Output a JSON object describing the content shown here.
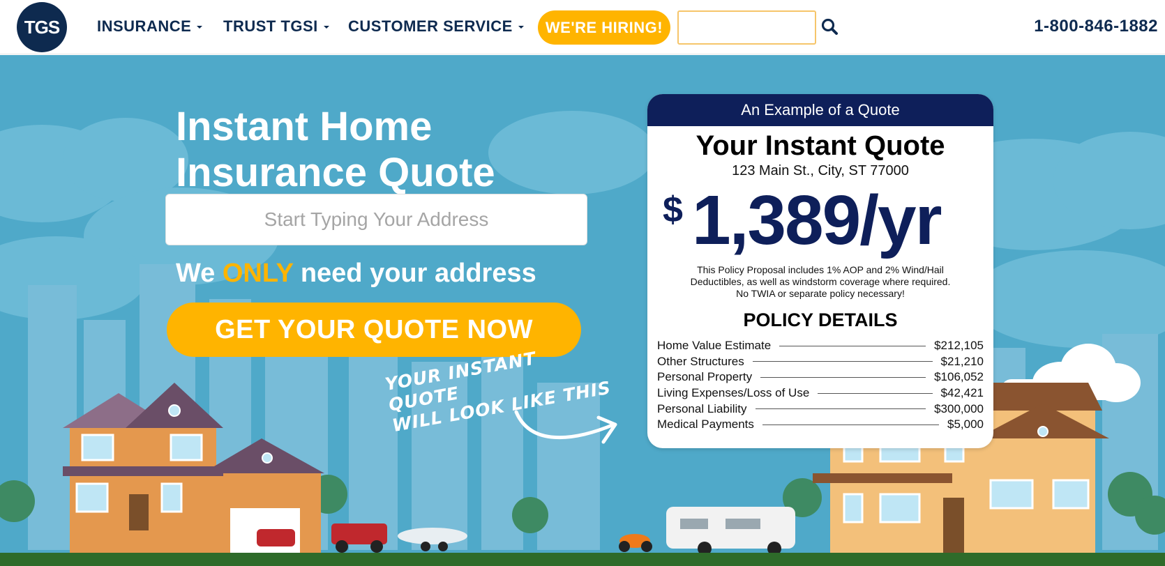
{
  "nav": {
    "logo_text": "TGS",
    "items": [
      {
        "label": "INSURANCE"
      },
      {
        "label": "TRUST TGSI"
      },
      {
        "label": "CUSTOMER SERVICE"
      }
    ],
    "hiring_label": "WE'RE HIRING!",
    "search": {
      "value": "",
      "placeholder": ""
    },
    "phone": "1-800-846-1882"
  },
  "hero": {
    "headline_line1": "Instant Home",
    "headline_line2": "Insurance Quote",
    "address_placeholder": "Start Typing Your Address",
    "only_prefix": "We ",
    "only_word": "ONLY",
    "only_suffix": " need your address",
    "cta_label": "GET YOUR QUOTE NOW",
    "handwritten_line1": "YOUR INSTANT QUOTE",
    "handwritten_line2": "WILL LOOK LIKE THIS"
  },
  "quote_card": {
    "header": "An Example of a Quote",
    "title": "Your Instant Quote",
    "address": "123 Main St., City, ST 77000",
    "currency": "$",
    "amount": "1,389/yr",
    "disclaimer_line1": "This Policy Proposal includes 1% AOP and 2% Wind/Hail",
    "disclaimer_line2": "Deductibles, as well as windstorm coverage where required.",
    "disclaimer_line3": "No TWIA or separate policy necessary!",
    "details_title": "POLICY DETAILS",
    "details": [
      {
        "label": "Home Value Estimate",
        "value": "$212,105"
      },
      {
        "label": "Other Structures",
        "value": "$21,210"
      },
      {
        "label": "Personal Property",
        "value": "$106,052"
      },
      {
        "label": "Living Expenses/Loss of Use",
        "value": "$42,421"
      },
      {
        "label": "Personal Liability",
        "value": "$300,000"
      },
      {
        "label": "Medical Payments",
        "value": "$5,000"
      }
    ]
  },
  "colors": {
    "navy": "#0e2a4f",
    "accent_yellow": "#ffb400",
    "sky": "#4fa9c9",
    "card_header": "#0e1f5a"
  },
  "icons": {
    "search": "search-icon",
    "caret": "caret-down-icon"
  }
}
